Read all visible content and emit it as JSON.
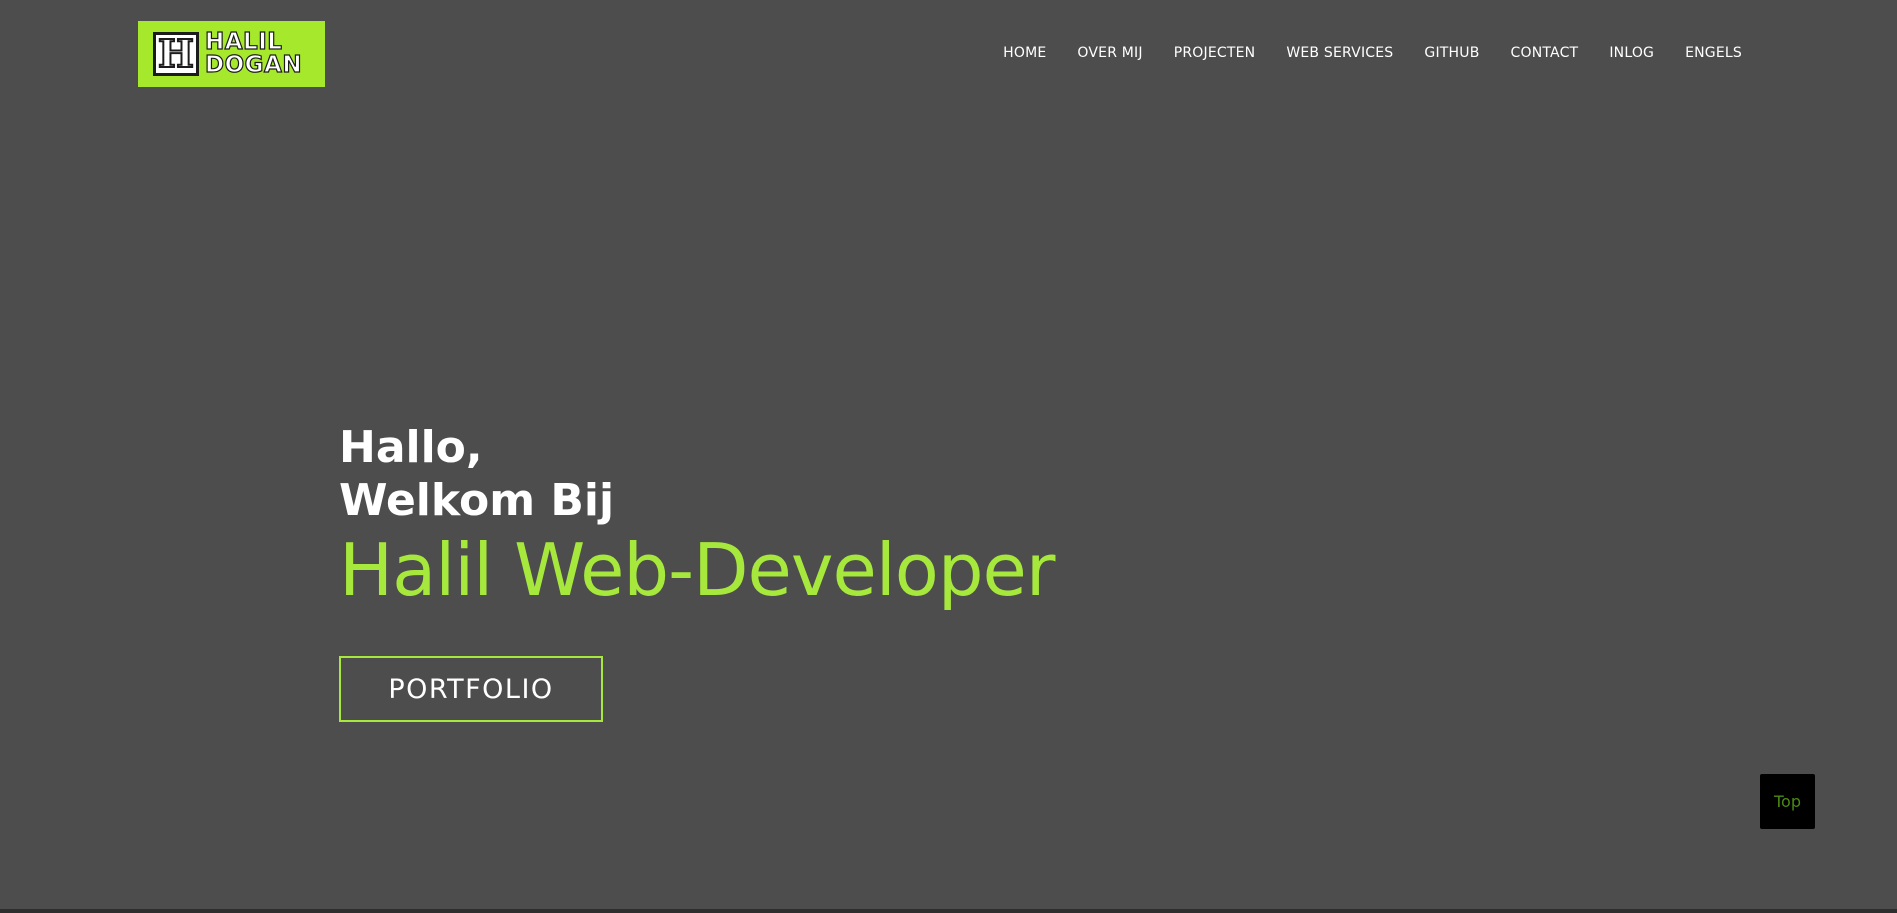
{
  "logo": {
    "mark_letter": "H",
    "line1": "HALIL",
    "line2": "DOGAN",
    "background_color": "#a6e82b"
  },
  "nav": {
    "items": [
      {
        "label": "HOME"
      },
      {
        "label": "OVER MIJ"
      },
      {
        "label": "PROJECTEN"
      },
      {
        "label": "WEB SERVICES"
      },
      {
        "label": "GITHUB"
      },
      {
        "label": "CONTACT"
      },
      {
        "label": "INLOG"
      },
      {
        "label": "ENGELS"
      }
    ]
  },
  "hero": {
    "greeting_line1": "Hallo,",
    "greeting_line2": "Welkom Bij",
    "headline": "Halil Web-Developer",
    "cta_label": "PORTFOLIO",
    "accent_color": "#a6e83c"
  },
  "scroll_top": {
    "label": "Top"
  },
  "colors": {
    "background": "#4d4d4d",
    "text": "#ffffff"
  }
}
